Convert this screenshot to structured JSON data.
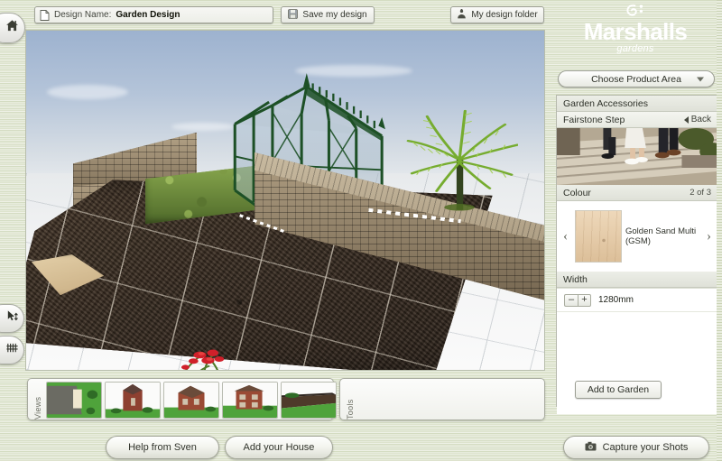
{
  "app": {
    "brand_name": "Marshalls",
    "brand_sub": "gardens",
    "accent_green": "#1f5b2a",
    "bg_green": "#dfe5d1"
  },
  "toolbar": {
    "home_icon": "home-icon",
    "design_name_label": "Design Name:",
    "design_name_value": "Garden Design",
    "design_name_placeholder": "Design Name",
    "doc_icon": "document-icon",
    "save_label": "Save my design",
    "save_icon": "floppy-disk-icon",
    "folder_label": "My design folder",
    "folder_icon": "folder-people-icon"
  },
  "left_rail": {
    "items": [
      {
        "name": "home",
        "icon": "home-icon"
      },
      {
        "name": "move",
        "icon": "cursor-move-icon"
      },
      {
        "name": "fence",
        "icon": "fence-icon"
      }
    ]
  },
  "viewport": {
    "scene_objects": [
      "greenhouse",
      "hedge",
      "retaining-wall",
      "soil-bed",
      "tree-fern",
      "flower-clump",
      "paving",
      "timber-plank"
    ]
  },
  "views_bar": {
    "label": "Views",
    "thumbnails": [
      {
        "name": "plan-view",
        "alt": "plan view"
      },
      {
        "name": "house-front-view",
        "alt": "house front"
      },
      {
        "name": "house-angle-view",
        "alt": "house angled"
      },
      {
        "name": "house-rear-view",
        "alt": "house rear"
      },
      {
        "name": "ground-level-view",
        "alt": "ground level"
      }
    ]
  },
  "tools_bar": {
    "label": "Tools"
  },
  "footer": {
    "help_label": "Help from Sven",
    "add_house_label": "Add your House",
    "capture_label": "Capture your Shots",
    "capture_icon": "camera-icon"
  },
  "sidebar": {
    "product_area_dropdown": {
      "selected": "Choose Product Area",
      "chevron_icon": "chevron-down-icon"
    },
    "category_header": "Garden Accessories",
    "product_header": {
      "title": "Fairstone Step",
      "back_label": "Back",
      "back_icon": "chevron-left-icon"
    },
    "hero_image_alt": "people walking down stone steps",
    "colour": {
      "header": "Colour",
      "count": "2 of 3",
      "prev_icon": "chevron-left-icon",
      "next_icon": "chevron-right-icon",
      "swatch_name": "Golden Sand Multi (GSM)",
      "swatch_hex": "#e3c7a4"
    },
    "width": {
      "header": "Width",
      "minus_label": "–",
      "plus_label": "+",
      "value": "1280mm"
    },
    "add_to_garden_label": "Add to Garden"
  }
}
